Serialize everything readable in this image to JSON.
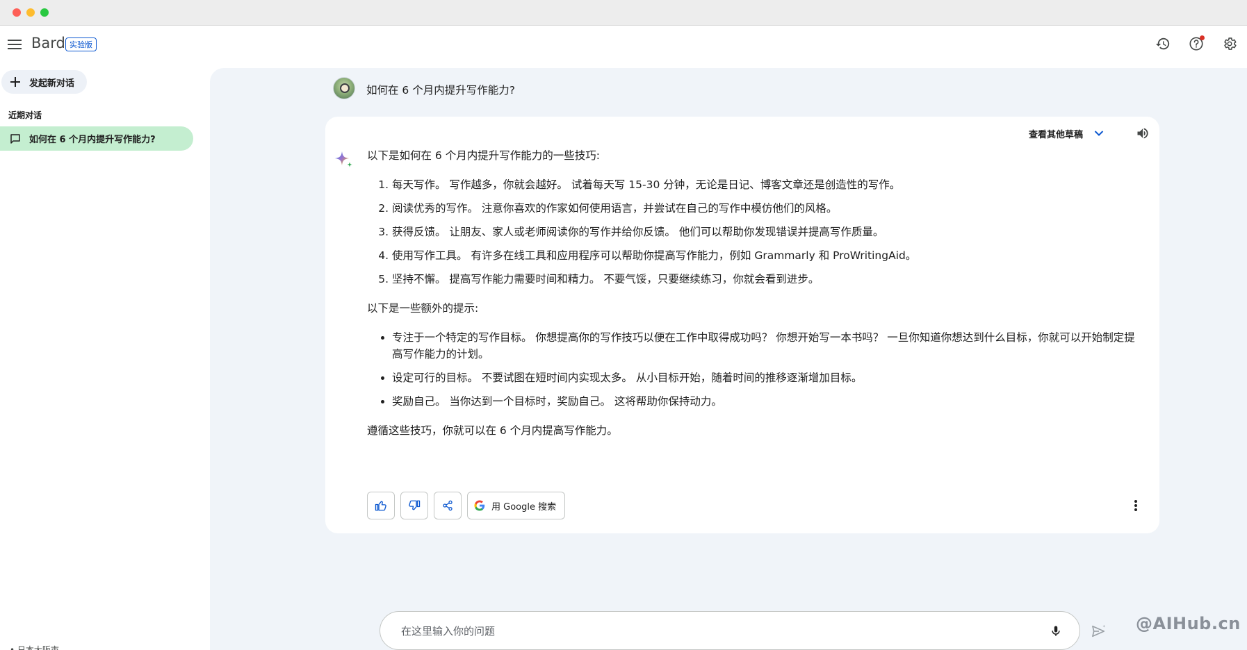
{
  "app": {
    "brand": "Bard",
    "badge": "实验版"
  },
  "sidebar": {
    "new_chat_label": "发起新对话",
    "recent_title": "近期对话",
    "recent_items": [
      {
        "label": "如何在 6 个月内提升写作能力?"
      }
    ],
    "footer": "• 日本大阪市"
  },
  "prompt": {
    "text": "如何在 6 个月内提升写作能力?"
  },
  "response": {
    "drafts_label": "查看其他草稿",
    "intro": "以下是如何在 6 个月内提升写作能力的一些技巧:",
    "steps": [
      "每天写作。 写作越多，你就会越好。 试着每天写 15-30 分钟，无论是日记、博客文章还是创造性的写作。",
      "阅读优秀的写作。 注意你喜欢的作家如何使用语言，并尝试在自己的写作中模仿他们的风格。",
      "获得反馈。 让朋友、家人或老师阅读你的写作并给你反馈。 他们可以帮助你发现错误并提高写作质量。",
      "使用写作工具。 有许多在线工具和应用程序可以帮助你提高写作能力，例如 Grammarly 和 ProWritingAid。",
      "坚持不懈。 提高写作能力需要时间和精力。 不要气馁，只要继续练习，你就会看到进步。"
    ],
    "extra_intro": "以下是一些额外的提示:",
    "tips": [
      "专注于一个特定的写作目标。 你想提高你的写作技巧以便在工作中取得成功吗？ 你想开始写一本书吗？ 一旦你知道你想达到什么目标，你就可以开始制定提高写作能力的计划。",
      "设定可行的目标。 不要试图在短时间内实现太多。 从小目标开始，随着时间的推移逐渐增加目标。",
      "奖励自己。 当你达到一个目标时，奖励自己。 这将帮助你保持动力。"
    ],
    "conclusion": "遵循这些技巧，你就可以在 6 个月内提高写作能力。",
    "google_search_label": "用 Google 搜索"
  },
  "input": {
    "placeholder": "在这里输入你的问题"
  },
  "watermark": "@AIHub.cn",
  "colors": {
    "accent": "#0b57d0",
    "sidebar_active": "#c4eed0",
    "main_bg": "#f0f4f9"
  }
}
